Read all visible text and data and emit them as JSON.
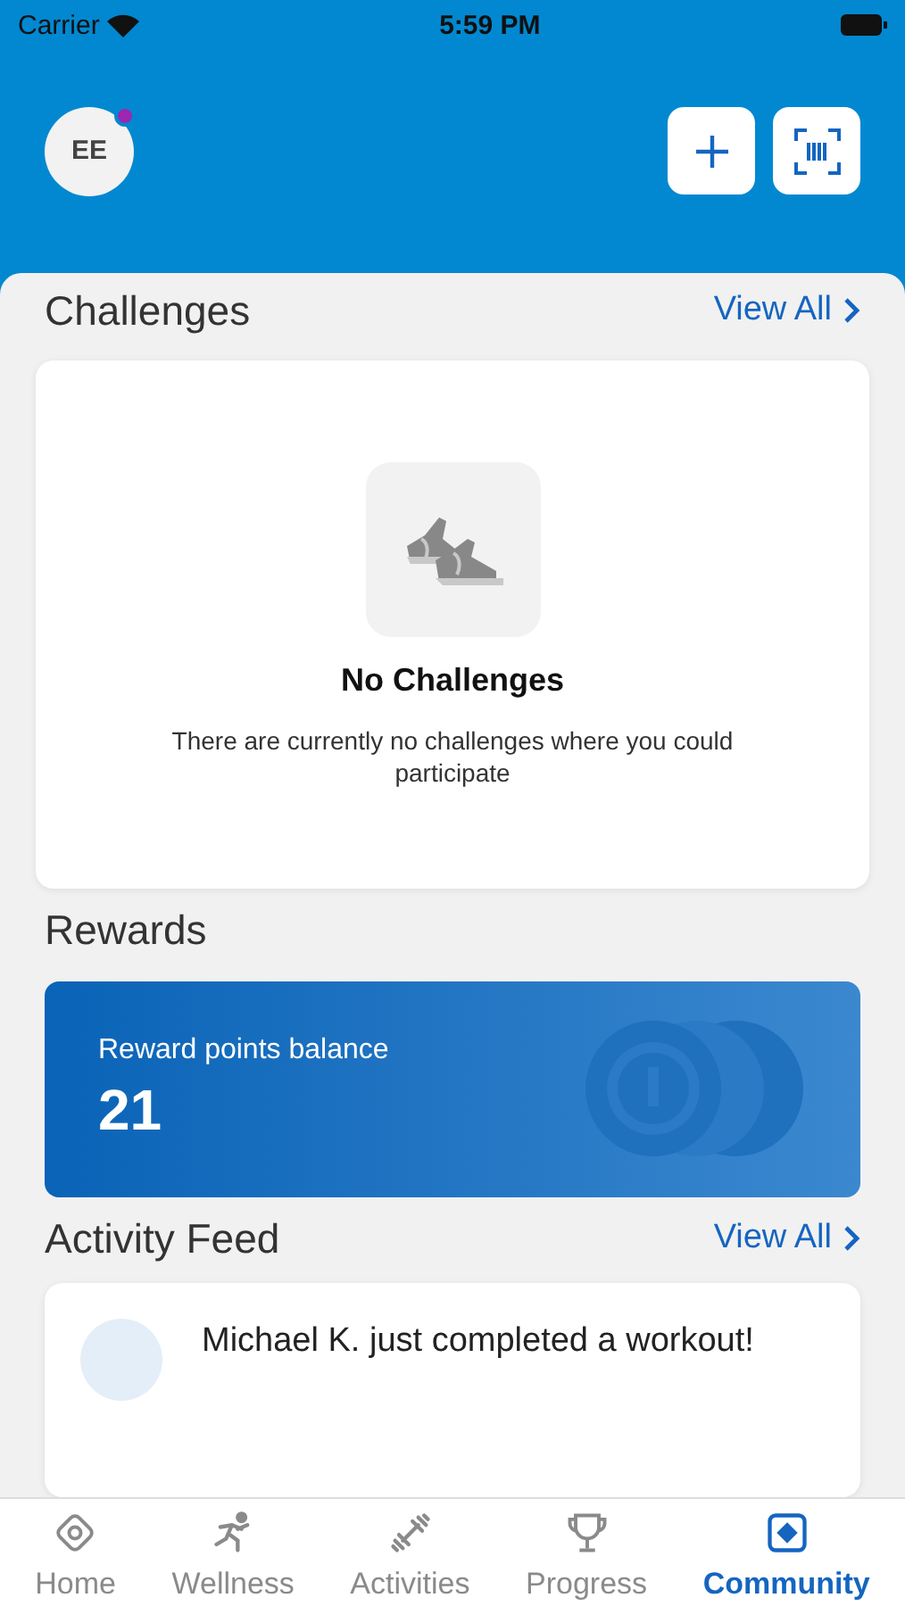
{
  "status_bar": {
    "carrier": "Carrier",
    "time": "5:59 PM"
  },
  "header": {
    "avatar": "EE",
    "notification": true
  },
  "challenges": {
    "title": "Challenges",
    "view_all": "View All",
    "empty_title": "No Challenges",
    "empty_text": "There are currently no challenges where you could participate"
  },
  "rewards": {
    "title": "Rewards",
    "label": "Reward points balance",
    "points": "21"
  },
  "activity_feed": {
    "title": "Activity Feed",
    "view_all": "View All",
    "items": [
      {
        "text": "Michael K. just completed a workout!"
      }
    ]
  },
  "tabs": [
    {
      "label": "Home",
      "selected": false
    },
    {
      "label": "Wellness",
      "selected": false
    },
    {
      "label": "Activities",
      "selected": false
    },
    {
      "label": "Progress",
      "selected": false
    },
    {
      "label": "Community",
      "selected": true
    }
  ]
}
